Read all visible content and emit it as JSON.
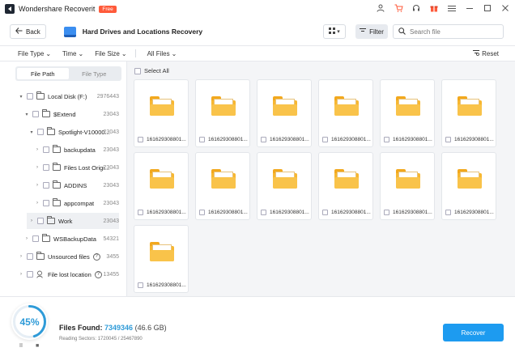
{
  "app": {
    "title": "Wondershare Recoverit",
    "badge": "Free"
  },
  "window_icons": [
    "user-icon",
    "cart-icon",
    "headset-icon",
    "gift-icon",
    "menu-icon",
    "minimize-icon",
    "maximize-icon",
    "close-icon"
  ],
  "toolbar": {
    "back_label": "Back",
    "page_title": "Hard Drives and Locations Recovery",
    "view_toggle": "▾",
    "filter_label": "Filter",
    "search_placeholder": "Search file"
  },
  "filters": {
    "items": [
      "File Type",
      "Time",
      "File Size",
      "All Files"
    ],
    "reset_label": "Reset"
  },
  "sidebar": {
    "tabs": [
      "File Path",
      "File Type"
    ],
    "active_tab": "File Path",
    "tree": [
      {
        "label": "Local Disk (F:)",
        "count": "2976443",
        "depth": 0,
        "expanded": true
      },
      {
        "label": "$Extend",
        "count": "23043",
        "depth": 1,
        "expanded": true
      },
      {
        "label": "Spotlight-V10000...",
        "count": "23043",
        "depth": 2,
        "expanded": true
      },
      {
        "label": "backupdata",
        "count": "23043",
        "depth": 3,
        "expanded": false
      },
      {
        "label": "Files Lost Origi...",
        "count": "23043",
        "depth": 3,
        "expanded": false
      },
      {
        "label": "ADDINS",
        "count": "23043",
        "depth": 3,
        "expanded": false
      },
      {
        "label": "appcompat",
        "count": "23043",
        "depth": 3,
        "expanded": false
      },
      {
        "label": "Work",
        "count": "23043",
        "depth": 2,
        "expanded": false,
        "selected": true
      },
      {
        "label": "WSBackupData",
        "count": "54321",
        "depth": 1,
        "expanded": false
      },
      {
        "label": "Unsourced files",
        "count": "3455",
        "depth": 0,
        "expanded": false,
        "help": true
      },
      {
        "label": "File lost location",
        "count": "13455",
        "depth": 0,
        "expanded": false,
        "help": true
      }
    ]
  },
  "content": {
    "select_all_label": "Select All",
    "files": [
      "161629308801...",
      "161629308801...",
      "161629308801...",
      "161629308801...",
      "161629308801...",
      "161629308801...",
      "161629308801...",
      "161629308801...",
      "161629308801...",
      "161629308801...",
      "161629308801...",
      "161629308801...",
      "161629308801..."
    ]
  },
  "status": {
    "progress_percent": 45,
    "progress_label": "45%",
    "files_found_label": "Files Found:",
    "files_found_count": "7349346",
    "files_found_size": "(46.6 GB)",
    "reading_sectors": "Reading Sectors: 1720045 / 25467890",
    "pause_label": "II",
    "stop_label": "■",
    "recover_label": "Recover"
  },
  "colors": {
    "accent": "#1d9bf0",
    "progress": "#2f9bd8",
    "badge": "#ff5a3a",
    "folder": "#f7b731"
  }
}
